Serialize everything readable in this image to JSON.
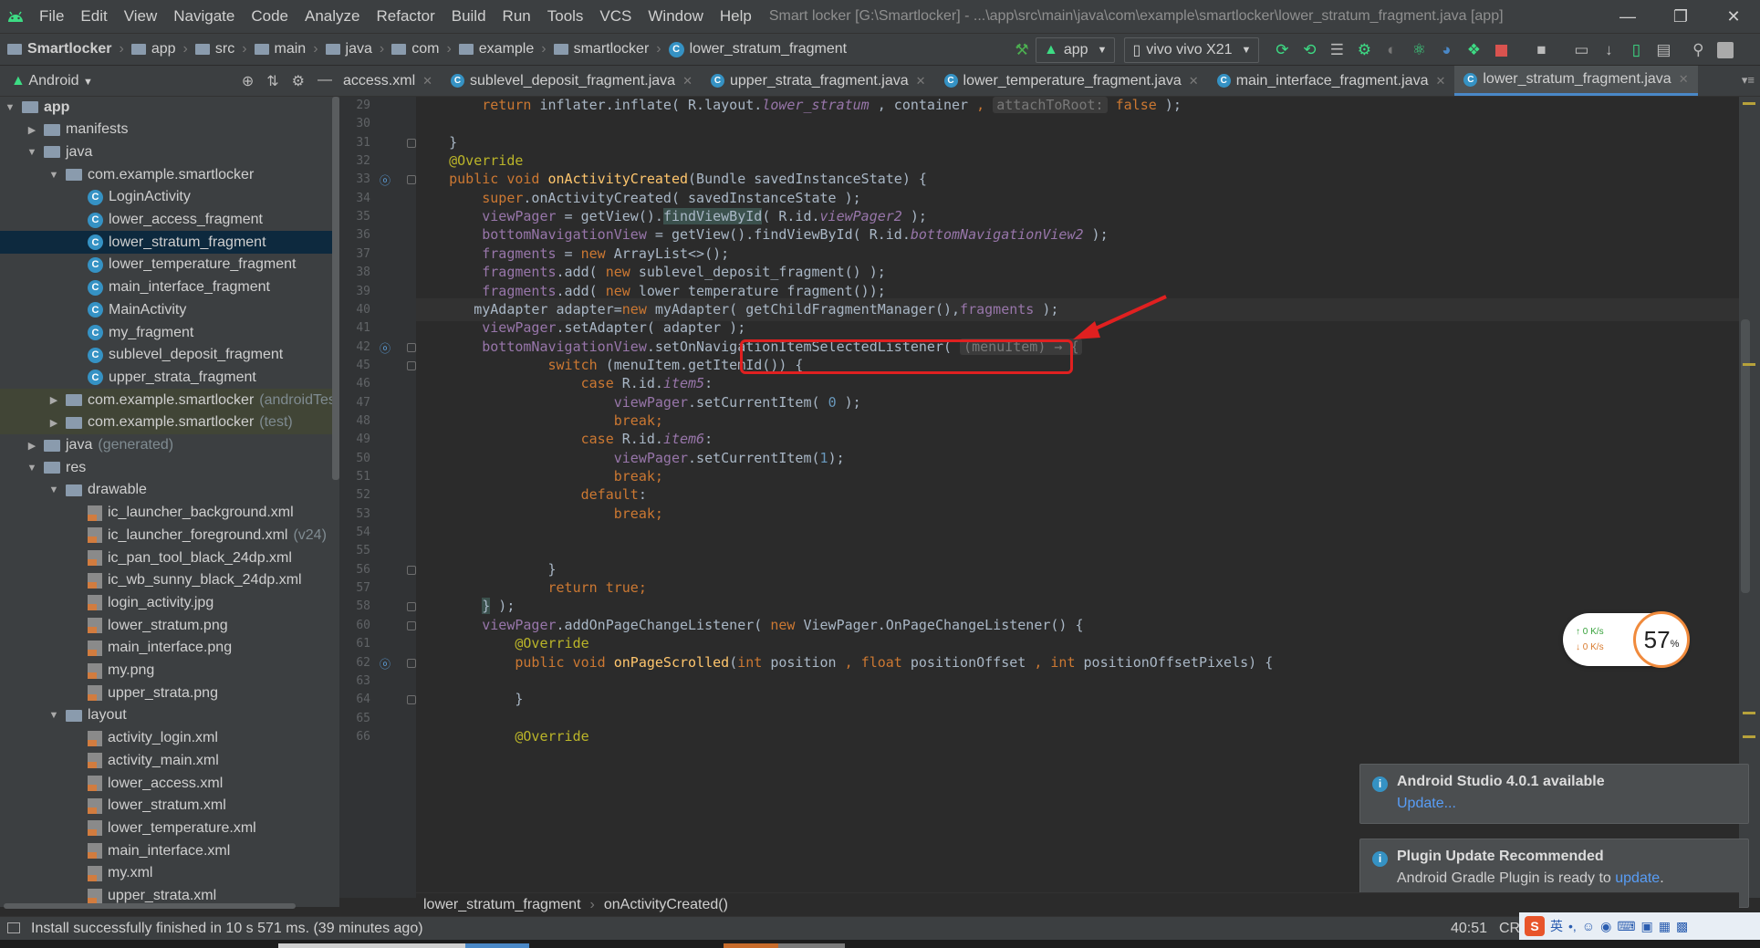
{
  "menu": [
    "File",
    "Edit",
    "View",
    "Navigate",
    "Code",
    "Analyze",
    "Refactor",
    "Build",
    "Run",
    "Tools",
    "VCS",
    "Window",
    "Help"
  ],
  "window_title": "Smart locker [G:\\Smartlocker] - ...\\app\\src\\main\\java\\com\\example\\smartlocker\\lower_stratum_fragment.java [app]",
  "nav_breadcrumb": [
    "Smartlocker",
    "app",
    "src",
    "main",
    "java",
    "com",
    "example",
    "smartlocker",
    "lower_stratum_fragment"
  ],
  "run_config": "app",
  "device": "vivo vivo X21",
  "project_panel": {
    "view": "Android",
    "tree": [
      {
        "label": "app",
        "depth": 0,
        "type": "module",
        "expanded": true
      },
      {
        "label": "manifests",
        "depth": 1,
        "type": "folder",
        "expanded": false
      },
      {
        "label": "java",
        "depth": 1,
        "type": "folder",
        "expanded": true
      },
      {
        "label": "com.example.smartlocker",
        "depth": 2,
        "type": "package",
        "expanded": true
      },
      {
        "label": "LoginActivity",
        "depth": 3,
        "type": "class"
      },
      {
        "label": "lower_access_fragment",
        "depth": 3,
        "type": "class"
      },
      {
        "label": "lower_stratum_fragment",
        "depth": 3,
        "type": "class",
        "selected": true
      },
      {
        "label": "lower_temperature_fragment",
        "depth": 3,
        "type": "class"
      },
      {
        "label": "main_interface_fragment",
        "depth": 3,
        "type": "class"
      },
      {
        "label": "MainActivity",
        "depth": 3,
        "type": "class"
      },
      {
        "label": "my_fragment",
        "depth": 3,
        "type": "class"
      },
      {
        "label": "sublevel_deposit_fragment",
        "depth": 3,
        "type": "class"
      },
      {
        "label": "upper_strata_fragment",
        "depth": 3,
        "type": "class"
      },
      {
        "label": "com.example.smartlocker",
        "suffix": "(androidTes",
        "depth": 2,
        "type": "package",
        "expanded": false,
        "module_tint": true
      },
      {
        "label": "com.example.smartlocker",
        "suffix": "(test)",
        "depth": 2,
        "type": "package",
        "expanded": false,
        "module_tint": true
      },
      {
        "label": "java",
        "suffix": "(generated)",
        "depth": 1,
        "type": "folder",
        "expanded": false
      },
      {
        "label": "res",
        "depth": 1,
        "type": "folder",
        "expanded": true
      },
      {
        "label": "drawable",
        "depth": 2,
        "type": "folder",
        "expanded": true
      },
      {
        "label": "ic_launcher_background.xml",
        "depth": 3,
        "type": "res"
      },
      {
        "label": "ic_launcher_foreground.xml",
        "suffix": "(v24)",
        "depth": 3,
        "type": "res"
      },
      {
        "label": "ic_pan_tool_black_24dp.xml",
        "depth": 3,
        "type": "res"
      },
      {
        "label": "ic_wb_sunny_black_24dp.xml",
        "depth": 3,
        "type": "res"
      },
      {
        "label": "login_activity.jpg",
        "depth": 3,
        "type": "res"
      },
      {
        "label": "lower_stratum.png",
        "depth": 3,
        "type": "res"
      },
      {
        "label": "main_interface.png",
        "depth": 3,
        "type": "res"
      },
      {
        "label": "my.png",
        "depth": 3,
        "type": "res"
      },
      {
        "label": "upper_strata.png",
        "depth": 3,
        "type": "res"
      },
      {
        "label": "layout",
        "depth": 2,
        "type": "folder",
        "expanded": true
      },
      {
        "label": "activity_login.xml",
        "depth": 3,
        "type": "res"
      },
      {
        "label": "activity_main.xml",
        "depth": 3,
        "type": "res"
      },
      {
        "label": "lower_access.xml",
        "depth": 3,
        "type": "res"
      },
      {
        "label": "lower_stratum.xml",
        "depth": 3,
        "type": "res"
      },
      {
        "label": "lower_temperature.xml",
        "depth": 3,
        "type": "res"
      },
      {
        "label": "main_interface.xml",
        "depth": 3,
        "type": "res"
      },
      {
        "label": "my.xml",
        "depth": 3,
        "type": "res"
      },
      {
        "label": "upper_strata.xml",
        "depth": 3,
        "type": "res"
      }
    ]
  },
  "tabs": [
    {
      "label": "access.xml",
      "type": "res"
    },
    {
      "label": "sublevel_deposit_fragment.java",
      "type": "class"
    },
    {
      "label": "upper_strata_fragment.java",
      "type": "class"
    },
    {
      "label": "lower_temperature_fragment.java",
      "type": "class"
    },
    {
      "label": "main_interface_fragment.java",
      "type": "class"
    },
    {
      "label": "lower_stratum_fragment.java",
      "type": "class",
      "active": true
    }
  ],
  "tabs_more": "▾≡",
  "code_lines": [
    {
      "n": 29,
      "html": "        <span class=\"kw\">return</span> inflater.inflate( R.layout.<span class=\"fldi\">lower_stratum</span> , container <span class=\"kw\">,</span> <span class=\"hint\">attachToRoot:</span> <span class=\"kw\">false</span> );"
    },
    {
      "n": 30,
      "html": ""
    },
    {
      "n": 31,
      "html": "    }",
      "fold": true
    },
    {
      "n": 32,
      "html": "    <span class=\"an\">@Override</span>"
    },
    {
      "n": 33,
      "html": "    <span class=\"kw\">public void</span> <span class=\"fn\">onActivityCreated</span>(Bundle savedInstanceState) {",
      "override": true,
      "fold": true
    },
    {
      "n": 34,
      "html": "        <span class=\"kw\">super</span>.onActivityCreated( savedInstanceState );"
    },
    {
      "n": 35,
      "html": "        <span class=\"fld\">viewPager</span> = getView().<span class=\"hl\">findViewById</span>( R.id.<span class=\"fldi\">viewPager2</span> );"
    },
    {
      "n": 36,
      "html": "        <span class=\"fld\">bottomNavigationView</span> = getView().findViewById( R.id.<span class=\"fldi\">bottomNavigationView2</span> );"
    },
    {
      "n": 37,
      "html": "        <span class=\"fld\">fragments</span> = <span class=\"kw\">new</span> ArrayList&lt;&gt;();"
    },
    {
      "n": 38,
      "html": "        <span class=\"fld\">fragments</span>.add( <span class=\"kw\">new</span> sublevel_deposit_fragment() );"
    },
    {
      "n": 39,
      "html": "        <span class=\"fld\">fragments</span>.add( <span class=\"kw\">new</span> lower_temperature_fragment());"
    },
    {
      "n": 40,
      "html": "       myAdapter adapter=<span class=\"kw\">new</span> myAdapter( getChildFragmentManager(),<span class=\"fld\">fragments</span> );",
      "current": true
    },
    {
      "n": 41,
      "html": "        <span class=\"fld\">viewPager</span>.setAdapter( adapter );"
    },
    {
      "n": 42,
      "html": "        <span class=\"fld\">bottomNavigationView</span>.setOnNavigationItemSelectedListener( <span class=\"hint\">(menuItem) → {</span>",
      "override": true,
      "fold": true
    },
    {
      "n": 45,
      "html": "                <span class=\"kw\">switch</span> (menuItem.getItemId()) {",
      "fold": true
    },
    {
      "n": 46,
      "html": "                    <span class=\"kw\">case</span> R.id.<span class=\"fldi\">item5</span>:"
    },
    {
      "n": 47,
      "html": "                        <span class=\"fld\">viewPager</span>.setCurrentItem( <span class=\"num\">0</span> );"
    },
    {
      "n": 48,
      "html": "                        <span class=\"kw\">break;</span>"
    },
    {
      "n": 49,
      "html": "                    <span class=\"kw\">case</span> R.id.<span class=\"fldi\">item6</span>:"
    },
    {
      "n": 50,
      "html": "                        <span class=\"fld\">viewPager</span>.setCurrentItem(<span class=\"num\">1</span>);"
    },
    {
      "n": 51,
      "html": "                        <span class=\"kw\">break;</span>"
    },
    {
      "n": 52,
      "html": "                    <span class=\"kw\">default</span>:"
    },
    {
      "n": 53,
      "html": "                        <span class=\"kw\">break;</span>"
    },
    {
      "n": 54,
      "html": ""
    },
    {
      "n": 55,
      "html": ""
    },
    {
      "n": 56,
      "html": "                }",
      "fold": true
    },
    {
      "n": 57,
      "html": "                <span class=\"kw\">return true;</span>"
    },
    {
      "n": 58,
      "html": "        <span class=\"hl\">}</span> );",
      "fold": true
    },
    {
      "n": 60,
      "html": "        <span class=\"fld\">viewPager</span>.addOnPageChangeListener( <span class=\"kw\">new</span> ViewPager.OnPageChangeListener() {",
      "fold": true
    },
    {
      "n": 61,
      "html": "            <span class=\"an\">@Override</span>"
    },
    {
      "n": 62,
      "html": "            <span class=\"kw\">public void</span> <span class=\"fn\">onPageScrolled</span>(<span class=\"kw\">int</span> position <span class=\"kw\">,</span> <span class=\"kw\">float</span> positionOffset <span class=\"kw\">,</span> <span class=\"kw\">int</span> positionOffsetPixels) {",
      "override": true,
      "fold": true
    },
    {
      "n": 63,
      "html": ""
    },
    {
      "n": 64,
      "html": "            }",
      "fold": true
    },
    {
      "n": 65,
      "html": ""
    },
    {
      "n": 66,
      "html": "            <span class=\"an\">@Override</span>"
    }
  ],
  "editor_breadcrumb": [
    "lower_stratum_fragment",
    "onActivityCreated()"
  ],
  "status": {
    "message": "Install successfully finished in 10 s 571 ms. (39 minutes ago)",
    "position": "40:51",
    "encoding": "CR"
  },
  "net_widget": {
    "up": "↑ 0   K/s",
    "down": "↓ 0   K/s",
    "percent": "57",
    "unit": "%"
  },
  "notifications": [
    {
      "title": "Android Studio 4.0.1 available",
      "body_prefix": "",
      "link": "Update...",
      "body_suffix": ""
    },
    {
      "title": "Plugin Update Recommended",
      "body_prefix": "Android Gradle Plugin is ready to ",
      "link": "update",
      "body_suffix": "."
    }
  ],
  "ime": {
    "lang": "英"
  },
  "colors": {
    "accent": "#4a88c7",
    "annotation": "#e02020",
    "keyword": "#cc7832",
    "method": "#ffc66d",
    "field": "#9876aa"
  }
}
